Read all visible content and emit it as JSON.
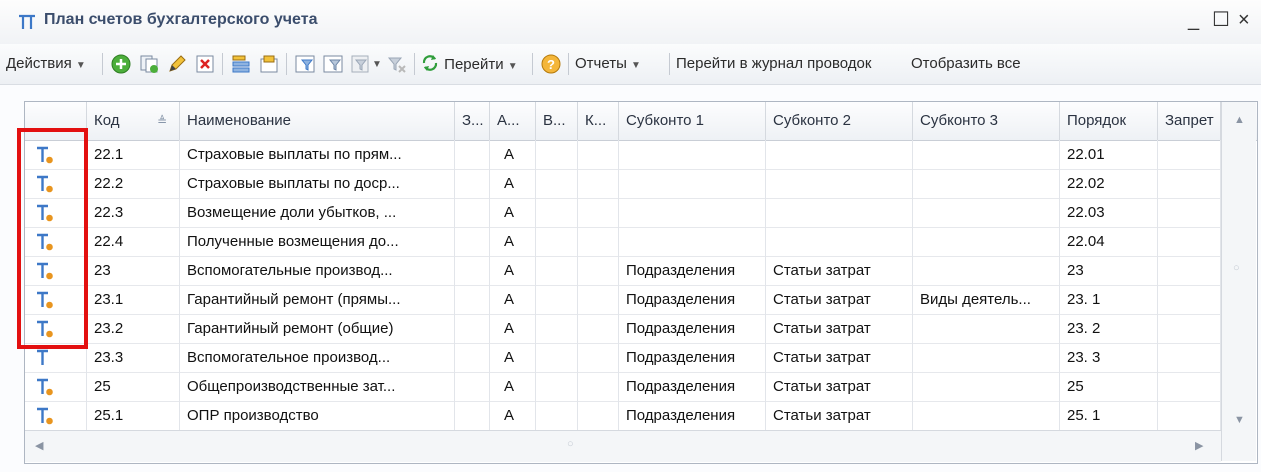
{
  "window": {
    "title": "План счетов бухгалтерского учета",
    "controls": {
      "minimize": "_",
      "maximize": "☐",
      "close": "×"
    }
  },
  "toolbar": {
    "actions_label": "Действия",
    "goto_label": "Перейти",
    "reports_label": "Отчеты",
    "journal_label": "Перейти в журнал проводок",
    "show_all_label": "Отобразить все",
    "icons": [
      "add-green-icon",
      "copy-icon",
      "edit-pencil-icon",
      "delete-icon",
      "hierarchy-icon",
      "level-up-icon",
      "filter-icon",
      "filter-select-icon",
      "filter-dropdown-icon",
      "clear-filter-icon",
      "refresh-icon",
      "help-icon"
    ]
  },
  "table": {
    "columns": [
      "",
      "Код",
      "Наименование",
      "З...",
      "А...",
      "В...",
      "К...",
      "Субконто 1",
      "Субконто 2",
      "Субконто 3",
      "Порядок",
      "Запрет"
    ],
    "rows": [
      {
        "icon": "T-group",
        "code": "22.1",
        "name": "Страховые выплаты по прям...",
        "a": "А",
        "sub1": "",
        "sub2": "",
        "sub3": "",
        "order": "22.01"
      },
      {
        "icon": "T-group",
        "code": "22.2",
        "name": "Страховые выплаты по доср...",
        "a": "А",
        "sub1": "",
        "sub2": "",
        "sub3": "",
        "order": "22.02"
      },
      {
        "icon": "T-group",
        "code": "22.3",
        "name": "Возмещение доли убытков, ...",
        "a": "А",
        "sub1": "",
        "sub2": "",
        "sub3": "",
        "order": "22.03"
      },
      {
        "icon": "T-group",
        "code": "22.4",
        "name": "Полученные возмещения до...",
        "a": "А",
        "sub1": "",
        "sub2": "",
        "sub3": "",
        "order": "22.04"
      },
      {
        "icon": "T-group",
        "code": "23",
        "name": "Вспомогательные производ...",
        "a": "А",
        "sub1": "Подразделения",
        "sub2": "Статьи затрат",
        "sub3": "",
        "order": "23"
      },
      {
        "icon": "T-group",
        "code": "23.1",
        "name": "Гарантийный ремонт (прямы...",
        "a": "А",
        "sub1": "Подразделения",
        "sub2": "Статьи затрат",
        "sub3": "Виды деятель...",
        "order": "23. 1"
      },
      {
        "icon": "T-group",
        "code": "23.2",
        "name": "Гарантийный ремонт (общие)",
        "a": "А",
        "sub1": "Подразделения",
        "sub2": "Статьи затрат",
        "sub3": "",
        "order": "23. 2"
      },
      {
        "icon": "T",
        "code": "23.3",
        "name": "Вспомогательное производ...",
        "a": "А",
        "sub1": "Подразделения",
        "sub2": "Статьи затрат",
        "sub3": "",
        "order": "23. 3"
      },
      {
        "icon": "T-group",
        "code": "25",
        "name": "Общепроизводственные зат...",
        "a": "А",
        "sub1": "Подразделения",
        "sub2": "Статьи затрат",
        "sub3": "",
        "order": "25"
      },
      {
        "icon": "T-group",
        "code": "25.1",
        "name": "ОПР производство",
        "a": "А",
        "sub1": "Подразделения",
        "sub2": "Статьи затрат",
        "sub3": "",
        "order": "25. 1"
      }
    ]
  },
  "colors": {
    "title": "#3b4d6c",
    "highlight": "#e31010",
    "icon_blue": "#3d78c7",
    "icon_orange": "#e8951f"
  }
}
